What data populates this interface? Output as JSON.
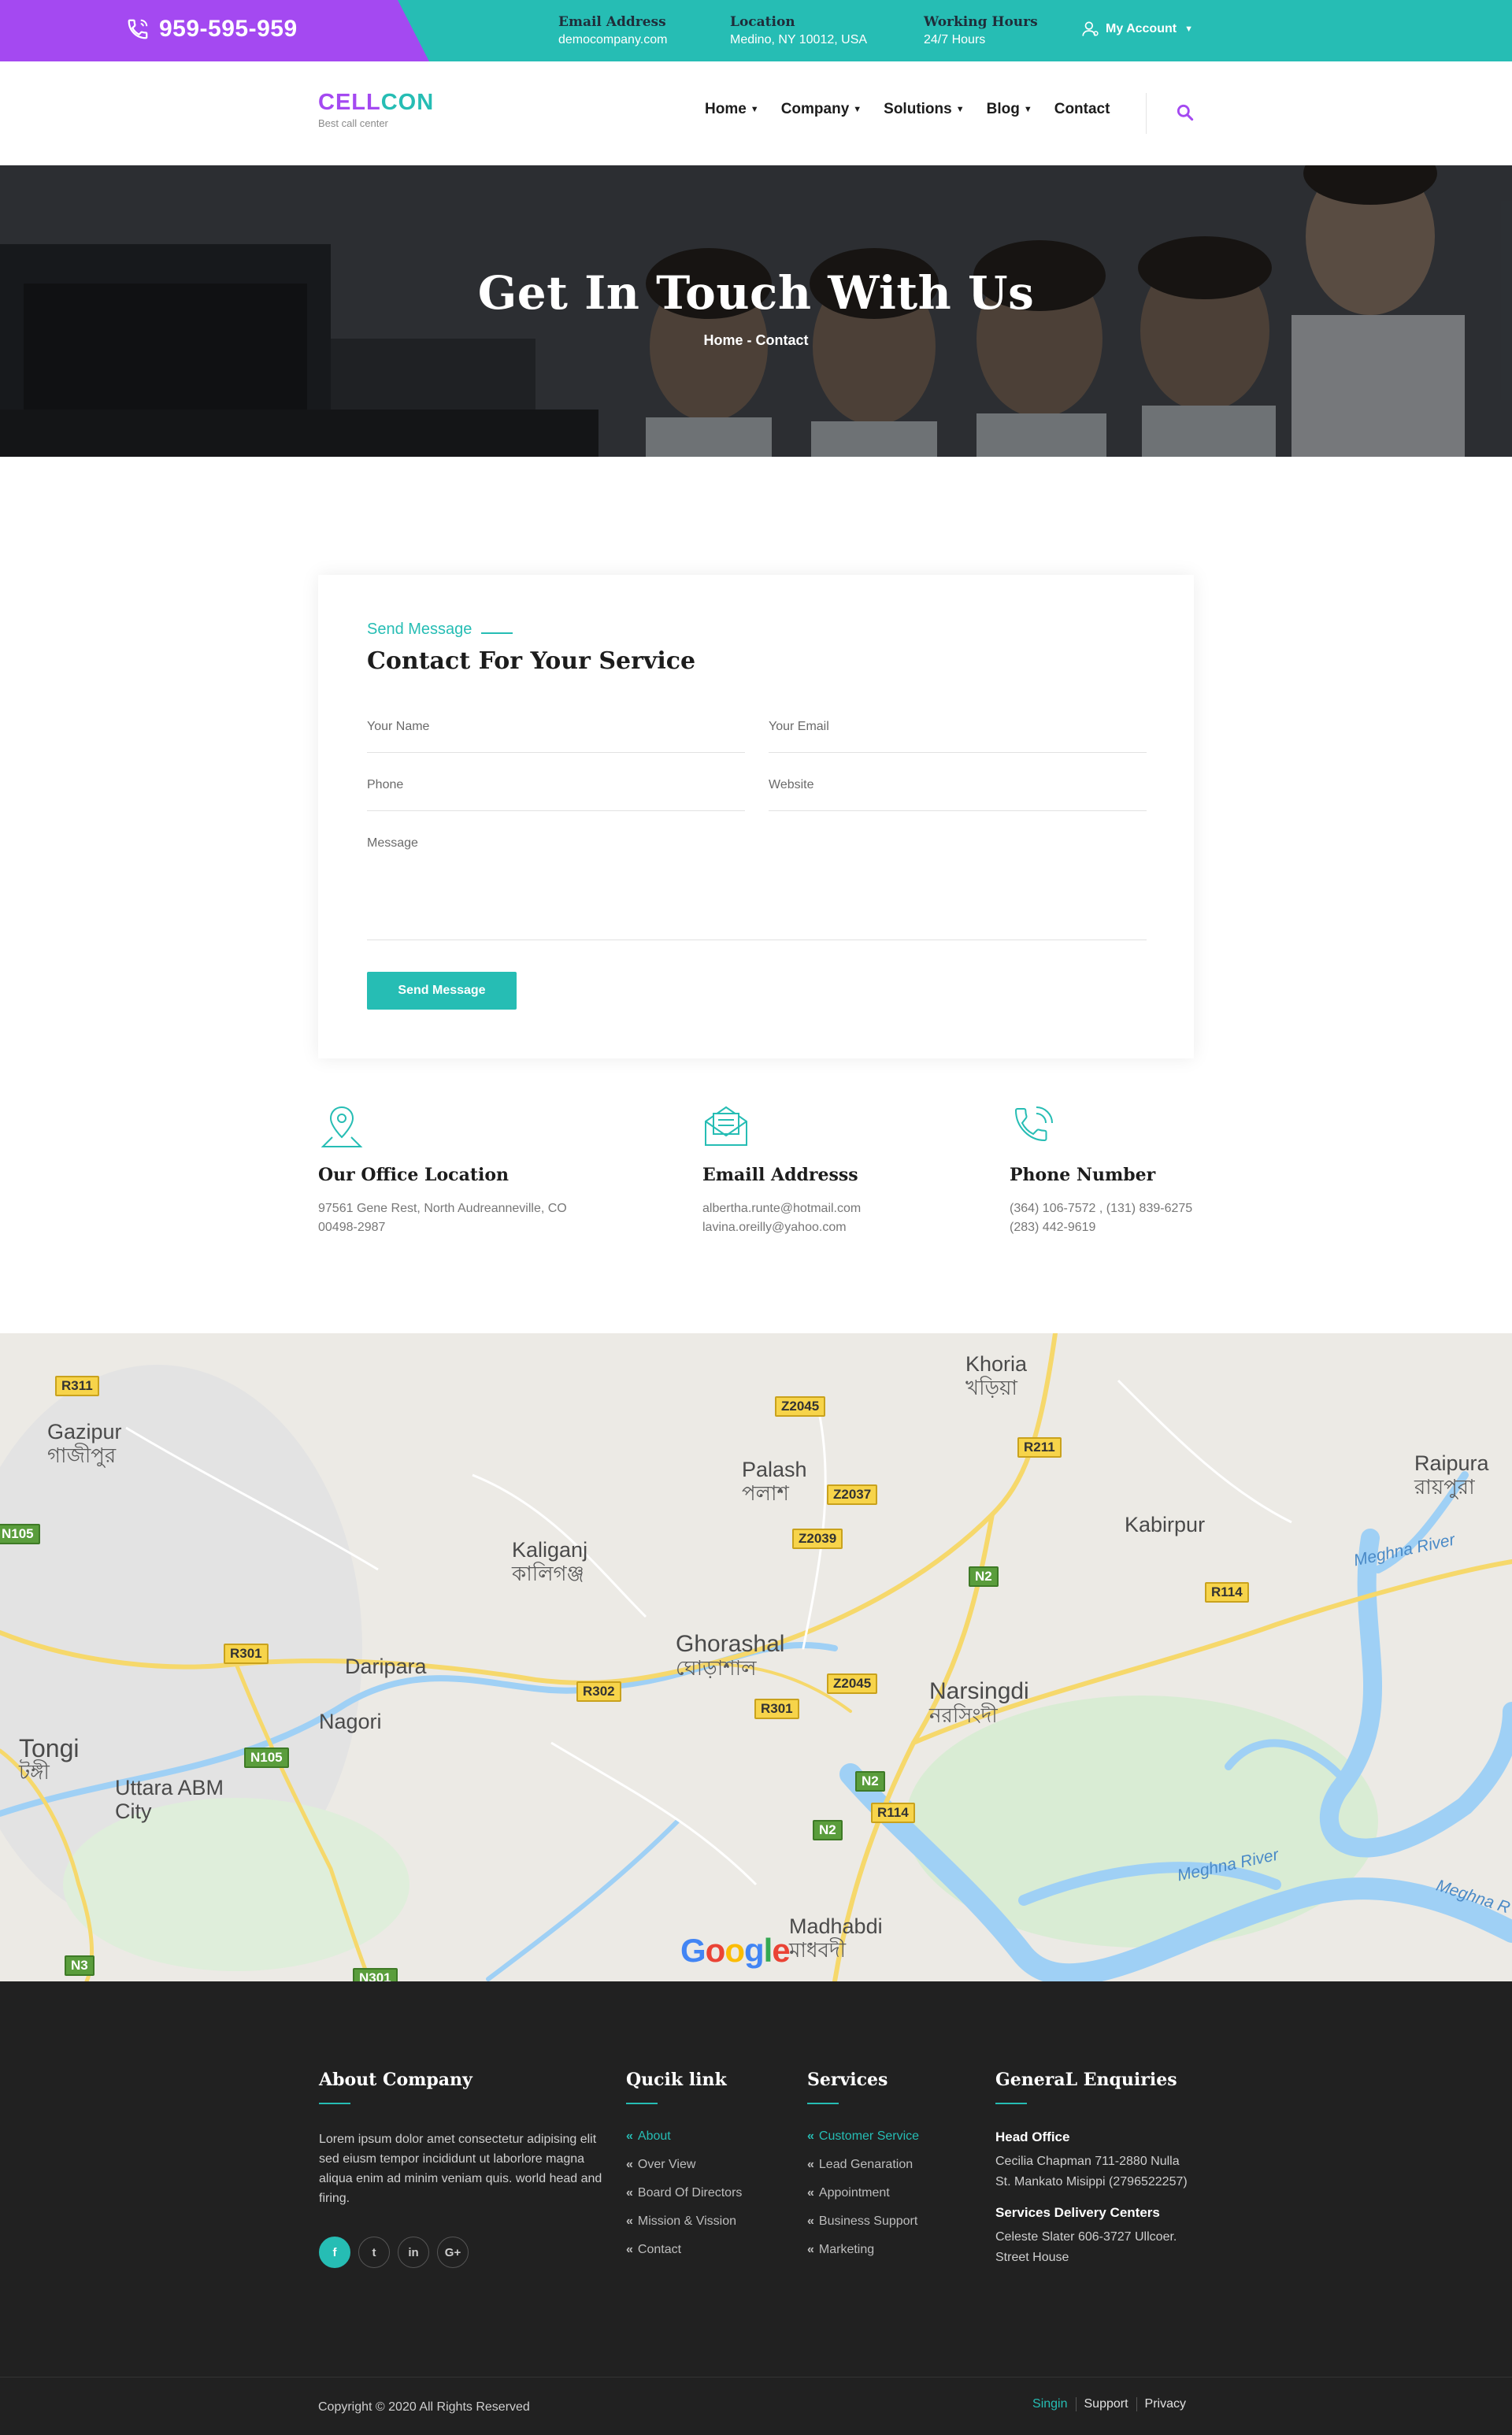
{
  "topbar": {
    "phone": "959-595-959",
    "email_label": "Email Address",
    "email_value": "democompany.com",
    "location_label": "Location",
    "location_value": "Medino, NY 10012, USA",
    "hours_label": "Working Hours",
    "hours_value": "24/7 Hours",
    "account": "My Account"
  },
  "brand": {
    "part1": "CELL",
    "part2": "CON",
    "tagline": "Best call center"
  },
  "nav": {
    "items": [
      {
        "label": "Home",
        "dropdown": true
      },
      {
        "label": "Company",
        "dropdown": true
      },
      {
        "label": "Solutions",
        "dropdown": true
      },
      {
        "label": "Blog",
        "dropdown": true
      },
      {
        "label": "Contact",
        "dropdown": false
      }
    ]
  },
  "hero": {
    "title": "Get In Touch With Us",
    "breadcrumb": "Home - Contact"
  },
  "form": {
    "eyebrow": "Send Message",
    "title": "Contact For Your Service",
    "name_placeholder": "Your Name",
    "email_placeholder": "Your Email",
    "phone_placeholder": "Phone",
    "website_placeholder": "Website",
    "message_placeholder": "Message",
    "submit": "Send Message"
  },
  "contact_info": {
    "office": {
      "title": "Our Office Location",
      "line1": "97561 Gene Rest, North Audreanneville, CO",
      "line2": "00498-2987"
    },
    "email": {
      "title": "Emaill Addresss",
      "line1": "albertha.runte@hotmail.com",
      "line2": "lavina.oreilly@yahoo.com"
    },
    "phone": {
      "title": "Phone Number",
      "line1": "(364) 106-7572 , (131) 839-6275",
      "line2": "(283) 442-9619"
    }
  },
  "map": {
    "places": [
      {
        "en": "Gazipur",
        "bn": "গাজীপুর"
      },
      {
        "en": "Khoria",
        "bn": "খড়িয়া"
      },
      {
        "en": "Palash",
        "bn": "পলাশ"
      },
      {
        "en": "Raipura",
        "bn": "রায়পুরা"
      },
      {
        "en": "Kaliganj",
        "bn": "কালিগঞ্জ"
      },
      {
        "en": "Kabirpur",
        "bn": ""
      },
      {
        "en": "Ghorashal",
        "bn": "ঘোড়াশাল"
      },
      {
        "en": "Daripara",
        "bn": ""
      },
      {
        "en": "Narsingdi",
        "bn": "নরসিংদী"
      },
      {
        "en": "Nagori",
        "bn": ""
      },
      {
        "en": "Tongi",
        "bn": "টঙ্গী"
      },
      {
        "en": "Uttara ABM City",
        "bn": ""
      },
      {
        "en": "Madhabdi",
        "bn": "মাধবদী"
      }
    ],
    "roads": [
      "R311",
      "Z2045",
      "R211",
      "Z2037",
      "N105",
      "Z2039",
      "N2",
      "R114",
      "R301",
      "R302",
      "Z2045",
      "R301",
      "N105",
      "N2",
      "R114",
      "N2",
      "N3",
      "N301"
    ],
    "rivers": [
      "Meghna River",
      "Meghna River",
      "Meghna R"
    ],
    "attribution": "Google"
  },
  "footer": {
    "about": {
      "title": "About Company",
      "text": "Lorem ipsum dolor amet consectetur adipising elit sed eiusm tempor incididunt ut laborlore magna aliqua enim ad minim veniam quis. world head and firing.",
      "social": [
        "f",
        "t",
        "in",
        "G+"
      ]
    },
    "quick": {
      "title": "Qucik link",
      "links": [
        "About",
        "Over View",
        "Board Of Directors",
        "Mission & Vission",
        "Contact"
      ]
    },
    "services": {
      "title": "Services",
      "links": [
        "Customer Service",
        "Lead Genaration",
        "Appointment",
        "Business Support",
        "Marketing"
      ]
    },
    "enquiries": {
      "title": "GeneraL Enquiries",
      "head_label": "Head Office",
      "head_line1": "Cecilia Chapman 711-2880 Nulla",
      "head_line2": "St. Mankato Misippi (2796522257)",
      "centers_label": "Services Delivery Centers",
      "centers_line1": "Celeste Slater 606-3727 Ullcoer.",
      "centers_line2": "Street House"
    },
    "copyright": "Copyright © 2020 All Rights Reserved",
    "bottom_links": [
      "Singin",
      "Support",
      "Privacy"
    ]
  },
  "colors": {
    "teal": "#26bdb4",
    "purple": "#a449f1",
    "footer_bg": "#212121"
  }
}
